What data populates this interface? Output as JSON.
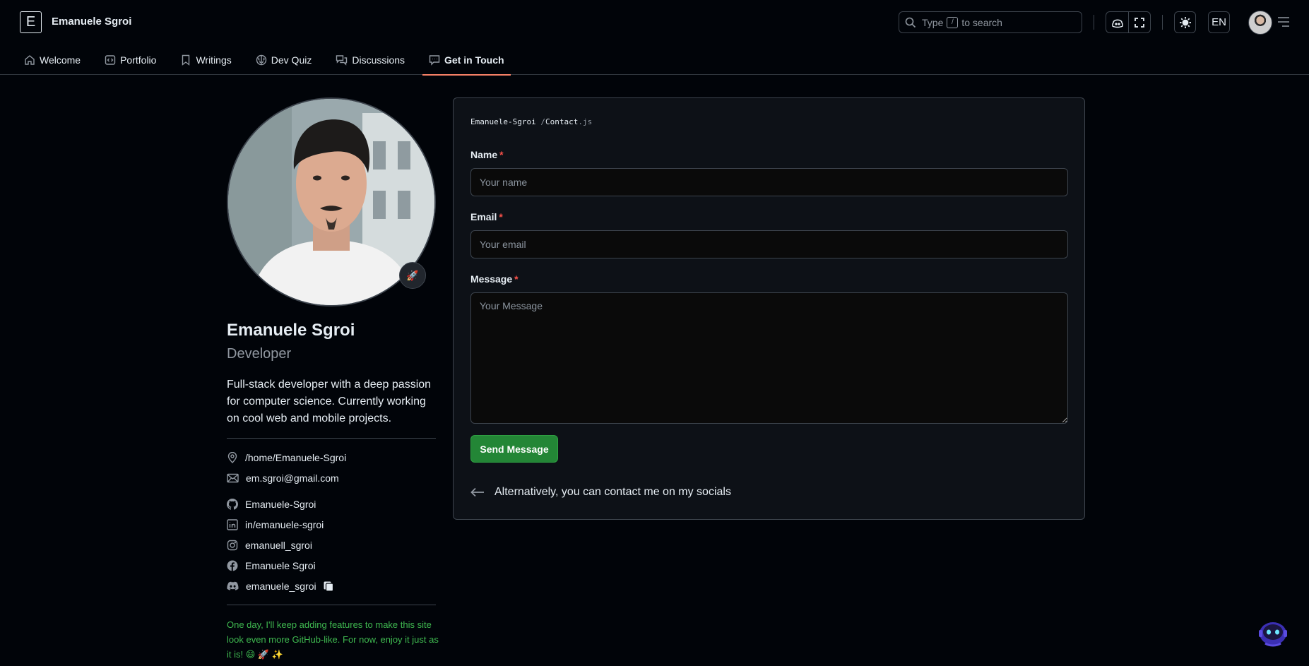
{
  "header": {
    "logo_letter": "E",
    "site_title": "Emanuele Sgroi",
    "search": {
      "prefix": "Type",
      "key": "/",
      "suffix": "to search"
    },
    "language": "EN"
  },
  "nav": {
    "items": [
      {
        "label": "Welcome",
        "icon": "home-icon"
      },
      {
        "label": "Portfolio",
        "icon": "code-icon"
      },
      {
        "label": "Writings",
        "icon": "bookmark-icon"
      },
      {
        "label": "Dev Quiz",
        "icon": "brain-icon"
      },
      {
        "label": "Discussions",
        "icon": "comment-discussion-icon"
      },
      {
        "label": "Get in Touch",
        "icon": "comment-icon",
        "active": true
      }
    ]
  },
  "profile": {
    "name": "Emanuele Sgroi",
    "role": "Developer",
    "status_emoji": "🚀",
    "bio": "Full-stack developer with a deep passion for computer science. Currently working on cool web and mobile projects.",
    "location": "/home/Emanuele-Sgroi",
    "email": "em.sgroi@gmail.com",
    "github": "Emanuele-Sgroi",
    "linkedin": "in/emanuele-sgroi",
    "instagram": "emanuell_sgroi",
    "facebook": "Emanuele Sgroi",
    "discord": "emanuele_sgroi",
    "footnote": "One day, I'll keep adding features to make this site look even more GitHub-like. For now, enjoy it just as it is! 😄 🚀 ✨"
  },
  "contact": {
    "breadcrumb": {
      "owner": "Emanuele-Sgroi",
      "sep": "/",
      "file": "Contact",
      "ext": ".js"
    },
    "name_label": "Name",
    "name_placeholder": "Your name",
    "email_label": "Email",
    "email_placeholder": "Your email",
    "message_label": "Message",
    "message_placeholder": "Your Message",
    "required_mark": "*",
    "send_label": "Send Message",
    "alt_text": "Alternatively, you can contact me on my socials"
  },
  "colors": {
    "background": "#010409",
    "card": "#0d1117",
    "border": "#3d444d",
    "accent_underline": "#f78166",
    "send_button": "#238636",
    "footnote_green": "#3fb950",
    "required_red": "#f85149"
  }
}
